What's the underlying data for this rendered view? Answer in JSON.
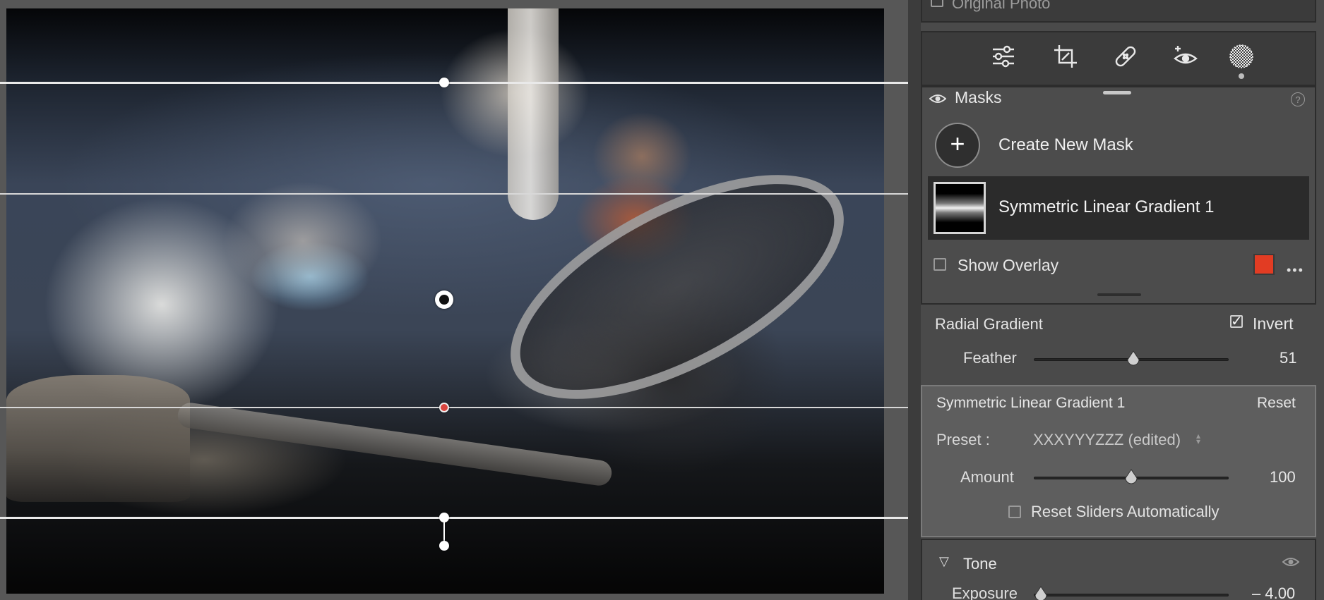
{
  "header": {
    "original_photo_label": "Original Photo"
  },
  "toolbar": {
    "tools": [
      {
        "name": "edit-sliders",
        "icon": "sliders-icon"
      },
      {
        "name": "crop",
        "icon": "crop-icon"
      },
      {
        "name": "healing",
        "icon": "bandage-icon"
      },
      {
        "name": "red-eye",
        "icon": "eye-plus-icon"
      },
      {
        "name": "masking",
        "icon": "mask-circle-icon"
      }
    ]
  },
  "masks": {
    "title": "Masks",
    "help": "?",
    "create_label": "Create New Mask",
    "plus": "+",
    "items": [
      {
        "label": "Symmetric Linear Gradient 1"
      }
    ],
    "show_overlay_label": "Show Overlay",
    "overlay_color": "#e23c23",
    "more": "•••"
  },
  "radial": {
    "title": "Radial Gradient",
    "invert_label": "Invert",
    "invert_checked": true,
    "feather_label": "Feather",
    "feather_value": "51",
    "feather_fraction": 0.51
  },
  "linear": {
    "title": "Symmetric Linear Gradient 1",
    "reset_label": "Reset",
    "preset_label": "Preset :",
    "preset_value": "XXXYYYZZZ (edited)",
    "amount_label": "Amount",
    "amount_value": "100",
    "amount_fraction": 0.5,
    "reset_sliders_label": "Reset Sliders Automatically"
  },
  "tone": {
    "title": "Tone",
    "exposure_label": "Exposure",
    "exposure_value": "– 4.00",
    "exposure_fraction": 0.0
  }
}
